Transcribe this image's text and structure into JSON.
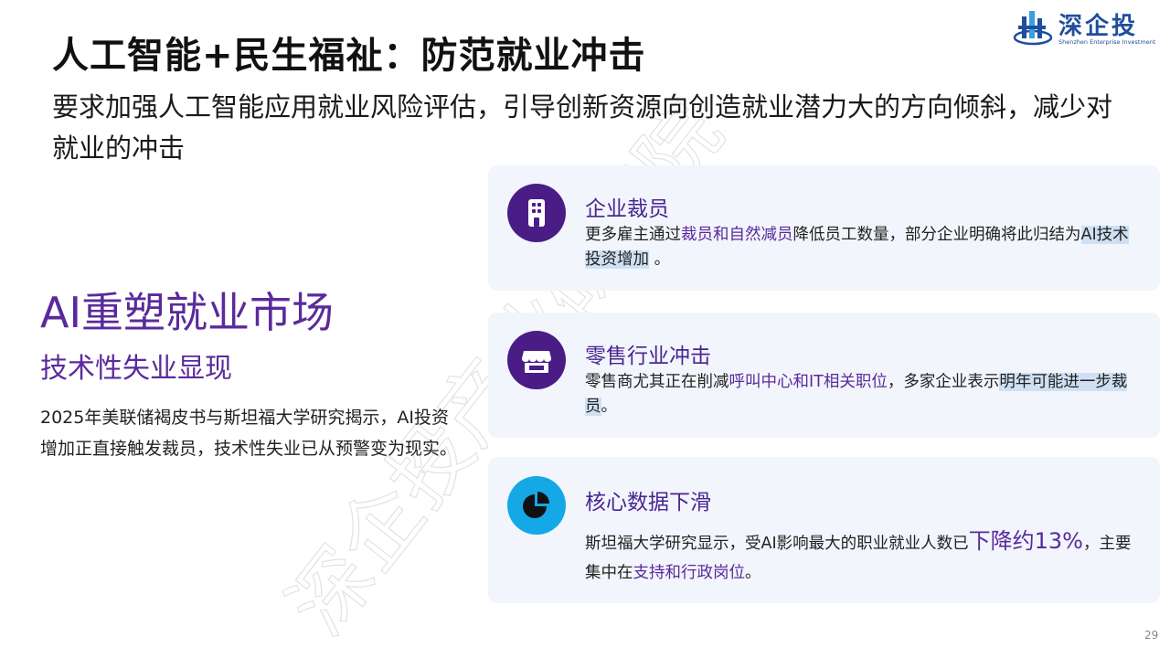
{
  "slide": {
    "title": "人工智能+民生福祉：防范就业冲击",
    "subtitle": "要求加强人工智能应用就业风险评估，引导创新资源向创造就业潜力大的方向倾斜，减少对就业的冲击",
    "page_number": "29"
  },
  "logo": {
    "text": "深企投",
    "sub": "Shenzhen Enterprise Investment",
    "watermark": "深企投产业研究院"
  },
  "left": {
    "heading": "AI重塑就业市场",
    "subheading": "技术性失业显现",
    "body": "2025年美联储褐皮书与斯坦福大学研究揭示，AI投资增加正直接触发裁员，技术性失业已从预警变为现实。"
  },
  "cards": [
    {
      "title": "企业裁员",
      "icon": "building-icon",
      "t1": "更多雇主通过",
      "t2": "裁员和自然减员",
      "t3": "降低员工数量，部分企业明确将此归结为",
      "t4": "AI技术投资增加",
      "t5": " 。"
    },
    {
      "title": "零售行业冲击",
      "icon": "store-icon",
      "t1": "零售商尤其正在削减",
      "t2": "呼叫中心和IT相关职位",
      "t3": "，多家企业表示",
      "t4": "明年可能进一步裁员",
      "t5": "。"
    },
    {
      "title": "核心数据下滑",
      "icon": "pie-chart-icon",
      "t1": "斯坦福大学研究显示，受AI影响最大的职业就业人数已",
      "t2": "下降约13%",
      "t3": "，主要集中在",
      "t4": "支持和行政岗位",
      "t5": "。"
    }
  ],
  "colors": {
    "accent_purple": "#5a2a9c",
    "icon_dark_purple": "#4a1d86",
    "icon_cyan": "#14a8e6",
    "card_bg": "#f2f5fb",
    "highlight_blue": "#cfe0f3"
  }
}
